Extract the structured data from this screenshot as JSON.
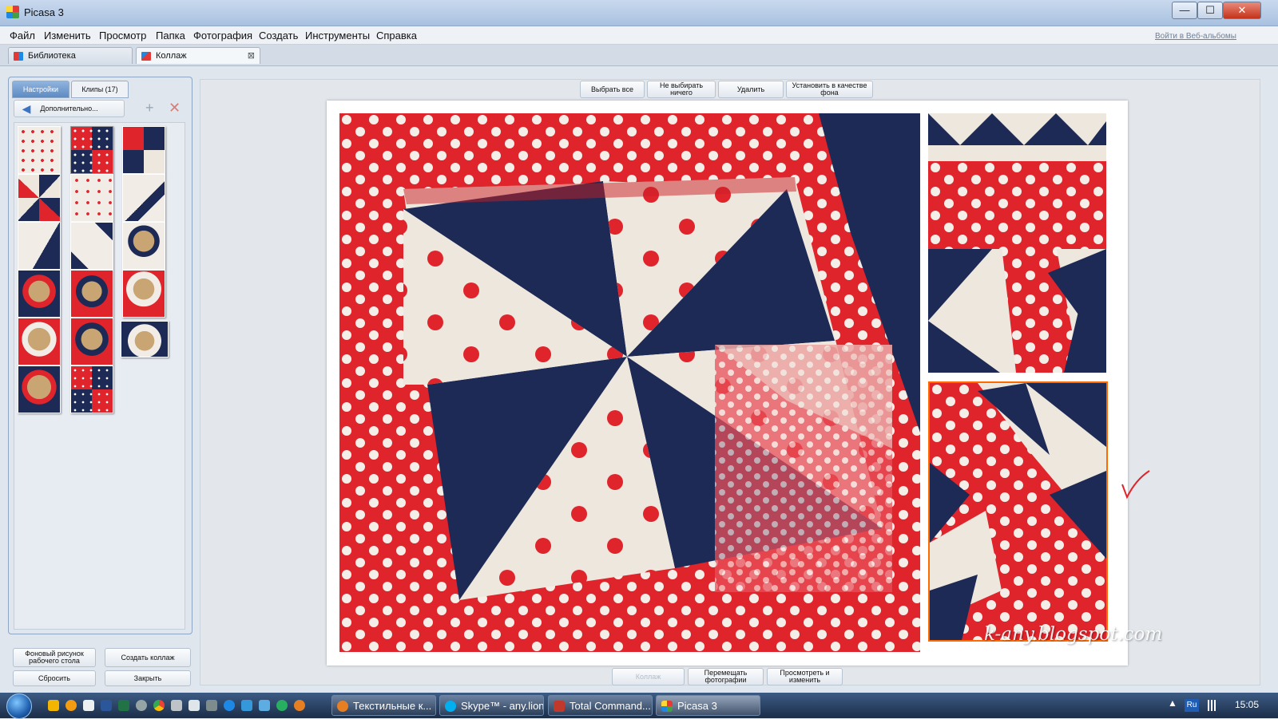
{
  "window": {
    "title": "Picasa 3",
    "min_glyph": "—",
    "max_glyph": "☐",
    "close_glyph": "✕"
  },
  "menu": {
    "items": [
      "Файл",
      "Изменить",
      "Просмотр",
      "Папка",
      "Фотография",
      "Создать",
      "Инструменты",
      "Справка"
    ],
    "signin": "Войти в Веб-альбомы"
  },
  "tabs": [
    {
      "label": "Библиотека",
      "icon": "library-icon"
    },
    {
      "label": "Коллаж",
      "icon": "collage-icon",
      "close": "⊠"
    }
  ],
  "left_panel": {
    "tabs": [
      "Настройки",
      "Клипы (17)"
    ],
    "more_button": "Дополнительно...",
    "add_glyph": "+",
    "remove_glyph": "✕",
    "clip_count": 17,
    "buttons": {
      "wallpaper": "Фоновый рисунок рабочего стола",
      "create": "Создать коллаж",
      "reset": "Сбросить",
      "close": "Закрыть"
    }
  },
  "toolbar": {
    "select_all": "Выбрать все",
    "select_none": "Не выбирать ничего",
    "delete": "Удалить",
    "set_background": "Установить в качестве фона"
  },
  "bottom_buttons": {
    "collage": "Коллаж",
    "move_photos": "Перемещать фотографии",
    "view_edit": "Просмотреть и изменить"
  },
  "watermark": "k-any.blogspot.com",
  "colors": {
    "fabric_red": "#e0242c",
    "fabric_navy": "#1d2a55",
    "fabric_white": "#eee7dd",
    "check_red": "#e0242c"
  },
  "taskbar": {
    "tasks": [
      "Текстильные к...",
      "Skype™ - any.lion",
      "Total Command...",
      "Picasa 3"
    ],
    "lang": "Ru",
    "clock": "15:05"
  }
}
